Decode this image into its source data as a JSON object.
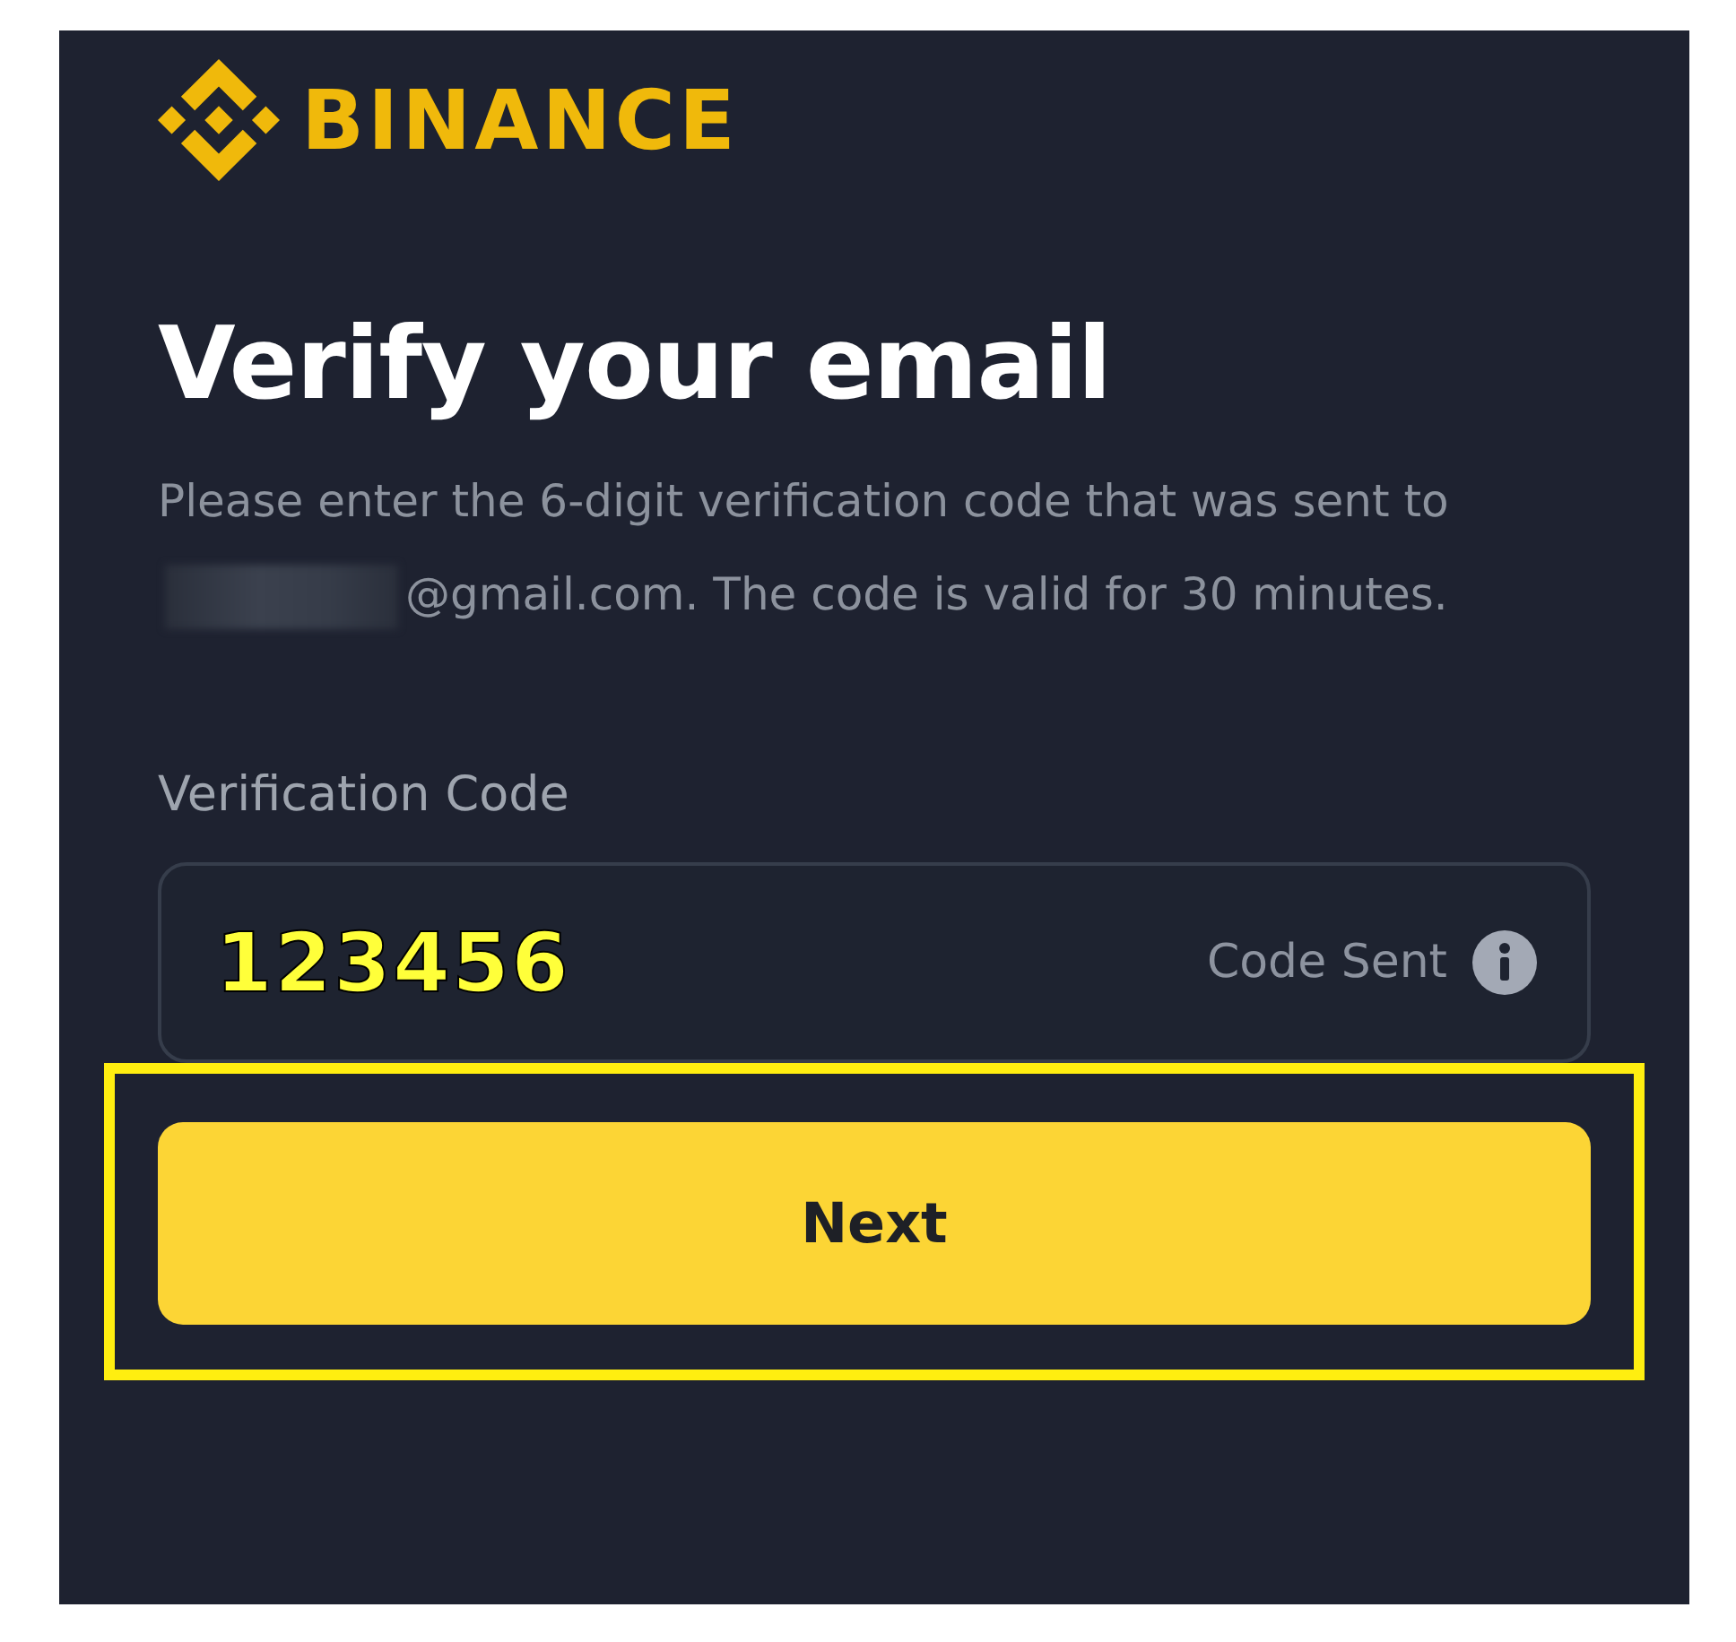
{
  "brand": {
    "name": "BINANCE"
  },
  "title": "Verify your email",
  "description": {
    "before": "Please enter the 6-digit verification code that was sent to",
    "redacted": true,
    "after": "@gmail.com. The code is valid for 30 minutes."
  },
  "verification_field": {
    "label": "Verification Code",
    "value": "123456",
    "status": "Code Sent"
  },
  "next_button": {
    "label": "Next",
    "highlighted": true
  }
}
